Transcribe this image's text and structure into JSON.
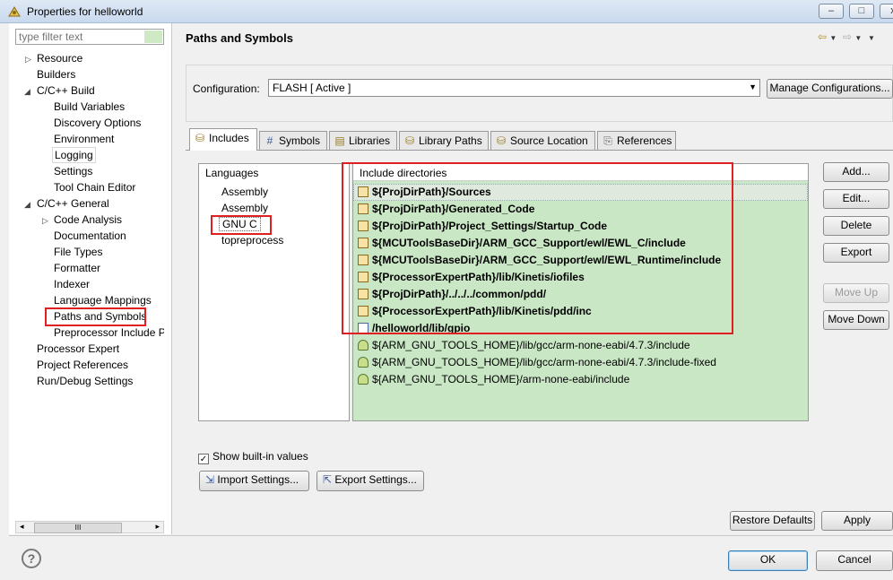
{
  "window": {
    "title": "Properties for helloworld",
    "min_label": "–",
    "max_label": "□",
    "close_label": "x"
  },
  "filter": {
    "placeholder": "type filter text"
  },
  "tree": {
    "resource": "Resource",
    "builders": "Builders",
    "cpp_build": "C/C++ Build",
    "build_variables": "Build Variables",
    "discovery_options": "Discovery Options",
    "environment": "Environment",
    "logging": "Logging",
    "settings": "Settings",
    "tool_chain_editor": "Tool Chain Editor",
    "cpp_general": "C/C++ General",
    "code_analysis": "Code Analysis",
    "documentation": "Documentation",
    "file_types": "File Types",
    "formatter": "Formatter",
    "indexer": "Indexer",
    "language_mappings": "Language Mappings",
    "paths_and_symbols": "Paths and Symbols",
    "preprocessor_include": "Preprocessor Include Pa",
    "processor_expert": "Processor Expert",
    "project_references": "Project References",
    "run_debug_settings": "Run/Debug Settings"
  },
  "page": {
    "title": "Paths and Symbols",
    "configuration_label": "Configuration:",
    "configuration_value": "FLASH  [ Active ]",
    "manage_configurations": "Manage Configurations..."
  },
  "tabs": [
    {
      "label": "Includes",
      "icon": "include-folder-icon"
    },
    {
      "label": "Symbols",
      "icon": "hash-icon"
    },
    {
      "label": "Libraries",
      "icon": "library-icon"
    },
    {
      "label": "Library Paths",
      "icon": "library-path-icon"
    },
    {
      "label": "Source Location",
      "icon": "source-folder-icon"
    },
    {
      "label": "References",
      "icon": "reference-icon"
    }
  ],
  "languages": {
    "header": "Languages",
    "items": [
      "Assembly",
      "Assembly",
      "GNU C",
      "topreprocess"
    ]
  },
  "include_dirs": {
    "header": "Include directories",
    "items": [
      "${ProjDirPath}/Sources",
      "${ProjDirPath}/Generated_Code",
      "${ProjDirPath}/Project_Settings/Startup_Code",
      "${MCUToolsBaseDir}/ARM_GCC_Support/ewl/EWL_C/include",
      "${MCUToolsBaseDir}/ARM_GCC_Support/ewl/EWL_Runtime/include",
      "${ProcessorExpertPath}/lib/Kinetis/iofiles",
      "${ProjDirPath}/../../../common/pdd/",
      "${ProcessorExpertPath}/lib/Kinetis/pdd/inc",
      "/helloworld/lib/gpio",
      "${ARM_GNU_TOOLS_HOME}/lib/gcc/arm-none-eabi/4.7.3/include",
      "${ARM_GNU_TOOLS_HOME}/lib/gcc/arm-none-eabi/4.7.3/include-fixed",
      "${ARM_GNU_TOOLS_HOME}/arm-none-eabi/include"
    ]
  },
  "side_buttons": {
    "add": "Add...",
    "edit": "Edit...",
    "delete": "Delete",
    "export": "Export",
    "move_up": "Move Up",
    "move_down": "Move Down"
  },
  "show_builtin": {
    "label": "Show built-in values",
    "checked": true
  },
  "import_settings": "Import Settings...",
  "export_settings": "Export Settings...",
  "restore_defaults": "Restore Defaults",
  "apply": "Apply",
  "ok": "OK",
  "cancel": "Cancel",
  "scroll_thumb": "III"
}
